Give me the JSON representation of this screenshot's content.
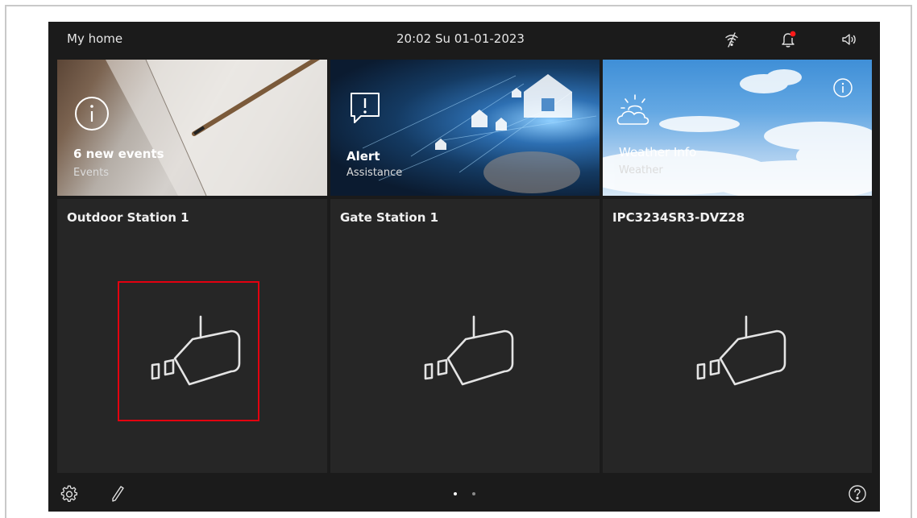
{
  "header": {
    "home_label": "My home",
    "clock": "20:02  Su 01-01-2023",
    "icons": [
      "wifi-off-icon",
      "bell-icon",
      "speaker-icon"
    ],
    "notification_dot_color": "#ff1a1a"
  },
  "tiles": [
    {
      "title": "6 new events",
      "subtitle": "Events",
      "icon": "info-icon"
    },
    {
      "title": "Alert",
      "subtitle": "Assistance",
      "icon": "alert-message-icon"
    },
    {
      "title": "Weather Info",
      "subtitle": "Weather",
      "icon": "weather-icon",
      "corner_icon": "info-icon"
    }
  ],
  "stations": [
    {
      "title": "Outdoor Station 1",
      "icon": "camera-icon",
      "highlighted": true
    },
    {
      "title": "Gate Station  1",
      "icon": "camera-icon"
    },
    {
      "title": "IPC3234SR3-DVZ28",
      "icon": "camera-icon"
    }
  ],
  "footer": {
    "icons": [
      "settings-icon",
      "edit-icon",
      "help-icon"
    ],
    "page_dots": 2,
    "active_page": 1
  },
  "colors": {
    "background": "#1b1b1b",
    "tile": "#262626",
    "highlight": "#e3000f"
  }
}
